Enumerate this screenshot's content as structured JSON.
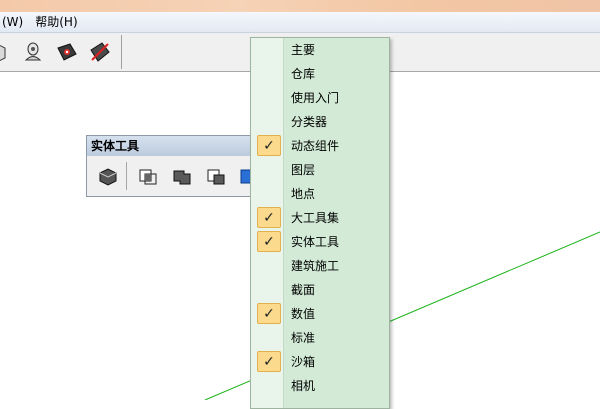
{
  "menubar": {
    "items": [
      "(W)",
      "帮助(H)"
    ]
  },
  "toolbar": {
    "icons": [
      "walk-tool-icon",
      "lookaround-tool-icon",
      "position-camera-icon",
      "section-plane-icon"
    ]
  },
  "float_toolbar": {
    "title": "实体工具",
    "icons": [
      "outer-shell-icon",
      "intersect-icon",
      "union-icon",
      "subtract-icon",
      "trim-icon"
    ]
  },
  "context_menu": {
    "items": [
      {
        "label": "主要",
        "checked": false
      },
      {
        "label": "仓库",
        "checked": false
      },
      {
        "label": "使用入门",
        "checked": false
      },
      {
        "label": "分类器",
        "checked": false
      },
      {
        "label": "动态组件",
        "checked": true
      },
      {
        "label": "图层",
        "checked": false
      },
      {
        "label": "地点",
        "checked": false
      },
      {
        "label": "大工具集",
        "checked": true
      },
      {
        "label": "实体工具",
        "checked": true
      },
      {
        "label": "建筑施工",
        "checked": false
      },
      {
        "label": "截面",
        "checked": false
      },
      {
        "label": "数值",
        "checked": true
      },
      {
        "label": "标准",
        "checked": false
      },
      {
        "label": "沙箱",
        "checked": true
      },
      {
        "label": "相机",
        "checked": false
      }
    ],
    "check_glyph": "✓"
  },
  "colors": {
    "menu_bg": "#d2ead6",
    "check_bg": "#fbd98d",
    "axis_green": "#1ab31a"
  }
}
